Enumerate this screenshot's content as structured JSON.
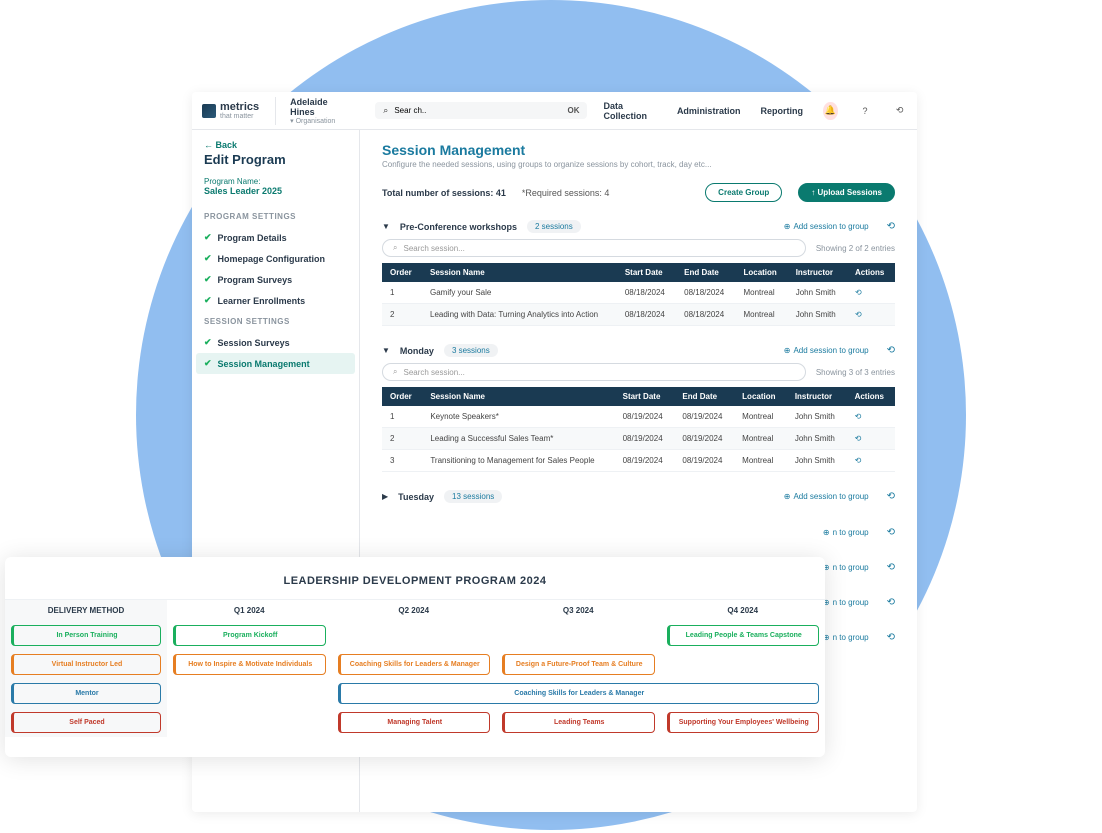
{
  "brand": {
    "name": "metrics",
    "tagline": "that matter"
  },
  "user": {
    "name": "Adelaide Hines",
    "scope": "Organisation"
  },
  "search": {
    "value": "Sear ch..",
    "ok": "OK"
  },
  "nav": {
    "data": "Data Collection",
    "admin": "Administration",
    "report": "Reporting"
  },
  "sidebar": {
    "back": "←  Back",
    "title": "Edit Program",
    "pn_label": "Program Name:",
    "pn_value": "Sales Leader 2025",
    "sec1": "PROGRAM SETTINGS",
    "sec2": "SESSION SETTINGS",
    "items1": [
      "Program Details",
      "Homepage Configuration",
      "Program Surveys",
      "Learner Enrollments"
    ],
    "items2": [
      "Session Surveys",
      "Session Management"
    ]
  },
  "main": {
    "title": "Session Management",
    "subtitle": "Configure the needed sessions, using groups to organize sessions by cohort, track, day etc...",
    "total": "Total number of sessions: 41",
    "required": "*Required sessions: 4",
    "create_group": "Create Group",
    "upload": "Upload Sessions",
    "search_placeholder": "Search session...",
    "add_session": "Add session to group",
    "cols": [
      "Order",
      "Session Name",
      "Start Date",
      "End Date",
      "Location",
      "Instructor",
      "Actions"
    ]
  },
  "groups": [
    {
      "name": "Pre-Conference workshops",
      "count": "2 sessions",
      "entries": "Showing 2 of 2 entries",
      "open": true,
      "rows": [
        {
          "order": "1",
          "name": "Gamify your Sale",
          "start": "08/18/2024",
          "end": "08/18/2024",
          "loc": "Montreal",
          "inst": "John Smith"
        },
        {
          "order": "2",
          "name": "Leading with Data: Turning Analytics into Action",
          "start": "08/18/2024",
          "end": "08/18/2024",
          "loc": "Montreal",
          "inst": "John Smith"
        }
      ]
    },
    {
      "name": "Monday",
      "count": "3 sessions",
      "entries": "Showing 3 of 3 entries",
      "open": true,
      "rows": [
        {
          "order": "1",
          "name": "Keynote Speakers*",
          "start": "08/19/2024",
          "end": "08/19/2024",
          "loc": "Montreal",
          "inst": "John Smith"
        },
        {
          "order": "2",
          "name": "Leading a Successful Sales Team*",
          "start": "08/19/2024",
          "end": "08/19/2024",
          "loc": "Montreal",
          "inst": "John Smith"
        },
        {
          "order": "3",
          "name": "Transitioning to Management for Sales People",
          "start": "08/19/2024",
          "end": "08/19/2024",
          "loc": "Montreal",
          "inst": "John Smith"
        }
      ]
    },
    {
      "name": "Tuesday",
      "count": "13 sessions",
      "open": false
    }
  ],
  "extra_groups_visible": 4,
  "overlay": {
    "title": "LEADERSHIP DEVELOPMENT PROGRAM 2024",
    "cols": [
      "DELIVERY METHOD",
      "Q1 2024",
      "Q2 2024",
      "Q3 2024",
      "Q4 2024"
    ],
    "legend": [
      "In Person Training",
      "Virtual Instructor Led",
      "Mentor",
      "Self Paced"
    ],
    "r1": {
      "q1": "Program Kickoff",
      "q4": "Leading People & Teams Capstone"
    },
    "r2": {
      "q1": "How to Inspire & Motivate Individuals",
      "q2": "Coaching Skills for Leaders & Manager",
      "q3": "Design a Future-Proof Team & Culture"
    },
    "r3": "Coaching Skills for Leaders & Manager",
    "r4": {
      "q2": "Managing Talent",
      "q3": "Leading Teams",
      "q4": "Supporting Your Employees' Wellbeing"
    }
  }
}
